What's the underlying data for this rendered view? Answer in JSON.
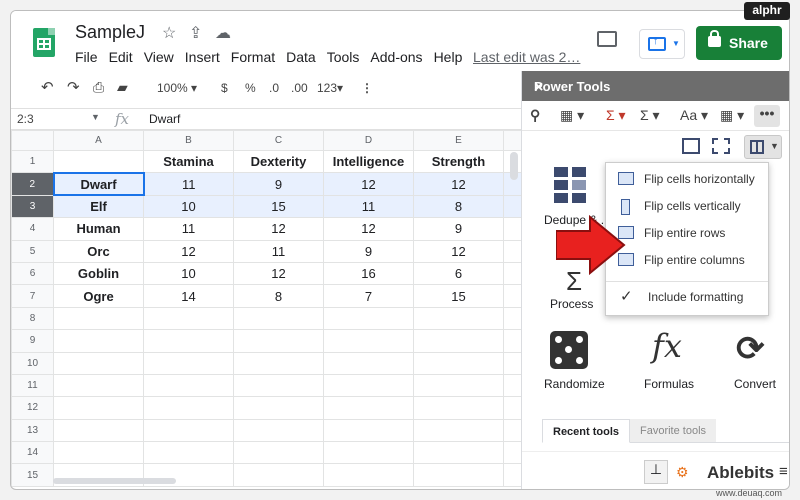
{
  "badge": "alphr",
  "watermark": "www.deuaq.com",
  "app": {
    "title": "SampleJ",
    "menus": [
      "File",
      "Edit",
      "View",
      "Insert",
      "Format",
      "Data",
      "Tools",
      "Add-ons",
      "Help"
    ],
    "last_edit": "Last edit was 2…",
    "share_label": "Share"
  },
  "toolbar": {
    "zoom": "100%",
    "currency": "$",
    "percent": "%",
    "dec_less": ".0",
    "dec_more": ".00",
    "format": "123"
  },
  "formula_bar": {
    "cell_ref": "2:3",
    "fx": "fx",
    "value": "Dwarf"
  },
  "grid": {
    "columns": [
      "A",
      "B",
      "C",
      "D",
      "E"
    ],
    "row_numbers": [
      "1",
      "2",
      "3",
      "4",
      "5",
      "6",
      "7",
      "8",
      "9",
      "10",
      "11",
      "12",
      "13",
      "14",
      "15"
    ],
    "headers": [
      "",
      "Stamina",
      "Dexterity",
      "Intelligence",
      "Strength"
    ],
    "rows": [
      [
        "Dwarf",
        "11",
        "9",
        "12",
        "12"
      ],
      [
        "Elf",
        "10",
        "15",
        "11",
        "8"
      ],
      [
        "Human",
        "11",
        "12",
        "12",
        "9"
      ],
      [
        "Orc",
        "12",
        "11",
        "9",
        "12"
      ],
      [
        "Goblin",
        "10",
        "12",
        "16",
        "6"
      ],
      [
        "Ogre",
        "14",
        "8",
        "7",
        "15"
      ]
    ]
  },
  "panel": {
    "title": "Power Tools",
    "close": "×",
    "toolbar_icons": [
      "find-icon",
      "table-icon",
      "sum-icon",
      "sigma-icon",
      "text-case-icon",
      "grid-icon",
      "more-icon"
    ],
    "tiles": {
      "dedupe": "Dedupe & ...",
      "process": "Process",
      "randomize": "Randomize",
      "formulas": "Formulas",
      "formulas_glyph": "fx",
      "convert": "Convert"
    },
    "tabs": {
      "recent": "Recent tools",
      "favorite": "Favorite tools"
    },
    "brand": "Ablebits"
  },
  "dropdown": {
    "items": [
      "Flip cells horizontally",
      "Flip cells vertically",
      "Flip entire rows",
      "Flip entire columns"
    ],
    "option": "Include formatting"
  },
  "colors": {
    "share": "#188038",
    "selection": "#e8f0fe",
    "header_bar": "#6d6d6d",
    "arrow": "#e8211f",
    "sheets_green": "#23a566"
  }
}
